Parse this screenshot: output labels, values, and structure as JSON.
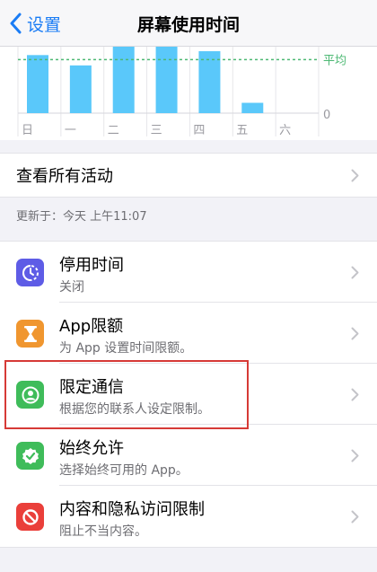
{
  "navbar": {
    "back_label": "设置",
    "title": "屏幕使用时间"
  },
  "chart_data": {
    "type": "bar",
    "categories": [
      "日",
      "一",
      "二",
      "三",
      "四",
      "五",
      "六"
    ],
    "values": [
      90,
      74,
      103,
      103,
      96,
      16,
      0
    ],
    "average_label": "平均",
    "zero_label": "0",
    "average_value": 83,
    "colors": {
      "bar": "#5ac8fa",
      "average_line": "#4cb873"
    }
  },
  "activity": {
    "label": "查看所有活动"
  },
  "updated": {
    "text": "更新于：今天 上午11:07"
  },
  "settings": [
    {
      "title": "停用时间",
      "subtitle": "关闭",
      "icon": "downtime-icon",
      "color": "#5e5ce6"
    },
    {
      "title": "App限额",
      "subtitle": "为 App 设置时间限额。",
      "icon": "hourglass-icon",
      "color": "#f0962f"
    },
    {
      "title": "限定通信",
      "subtitle": "根据您的联系人设定限制。",
      "icon": "contact-icon",
      "color": "#3fbc5a"
    },
    {
      "title": "始终允许",
      "subtitle": "选择始终可用的 App。",
      "icon": "checkmark-badge-icon",
      "color": "#3fbc5a"
    },
    {
      "title": "内容和隐私访问限制",
      "subtitle": "阻止不当内容。",
      "icon": "restriction-icon",
      "color": "#ea3f3a"
    }
  ]
}
